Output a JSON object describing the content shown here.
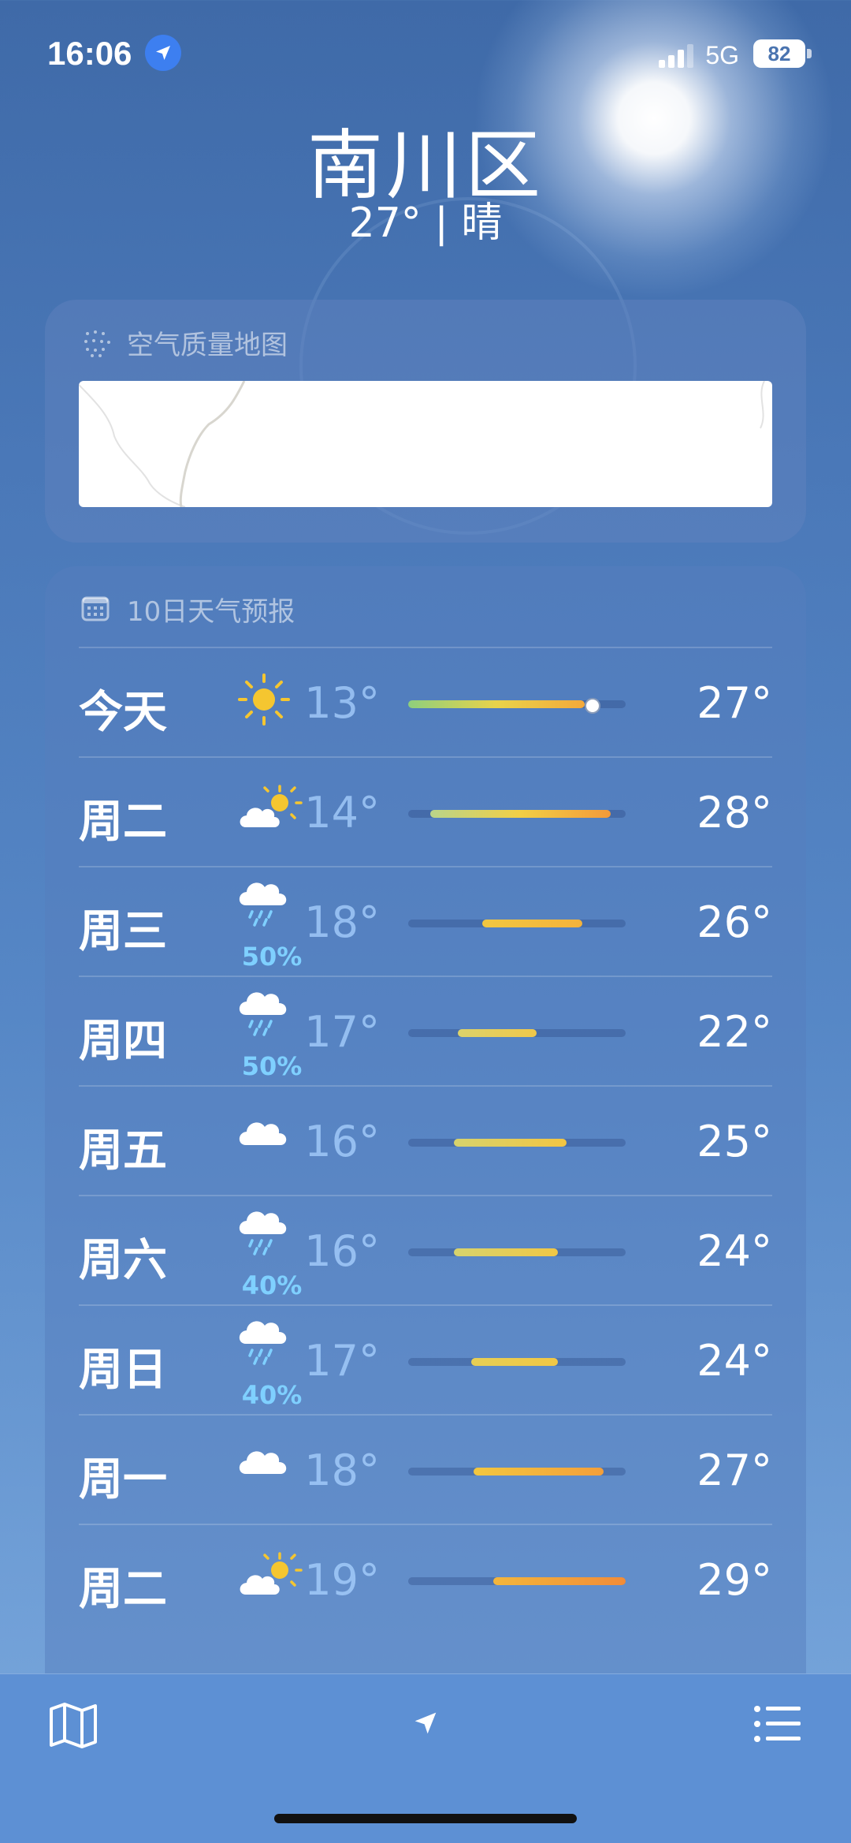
{
  "status": {
    "time": "16:06",
    "network": "5G",
    "battery": "82"
  },
  "location": {
    "city": "南川区",
    "summary": "27° | 晴"
  },
  "air_quality": {
    "title": "空气质量地图"
  },
  "forecast": {
    "title": "10日天气预报",
    "days": [
      {
        "day": "今天",
        "icon": "sun-icon",
        "precip": "",
        "low": "13°",
        "high": "27°",
        "bar_start": 0.0,
        "bar_end": 0.81,
        "current": 0.84,
        "color": "linear-gradient(90deg,#8ecf7d,#e9d34a,#f4a93a)"
      },
      {
        "day": "周二",
        "icon": "partly-sunny-icon",
        "precip": "",
        "low": "14°",
        "high": "28°",
        "bar_start": 0.1,
        "bar_end": 0.93,
        "color": "linear-gradient(90deg,#b9d48a,#f2cf45,#f39a3a)"
      },
      {
        "day": "周三",
        "icon": "cloud-rain-icon",
        "precip": "50%",
        "low": "18°",
        "high": "26°",
        "bar_start": 0.34,
        "bar_end": 0.8,
        "color": "linear-gradient(90deg,#f2c740,#f4b23b)"
      },
      {
        "day": "周四",
        "icon": "cloud-rain-icon",
        "precip": "50%",
        "low": "17°",
        "high": "22°",
        "bar_start": 0.23,
        "bar_end": 0.59,
        "color": "linear-gradient(90deg,#dcd26a,#f0c84a)"
      },
      {
        "day": "周五",
        "icon": "cloud-icon",
        "precip": "",
        "low": "16°",
        "high": "25°",
        "bar_start": 0.21,
        "bar_end": 0.73,
        "color": "linear-gradient(90deg,#d7d36d,#f3c542)"
      },
      {
        "day": "周六",
        "icon": "cloud-rain-icon",
        "precip": "40%",
        "low": "16°",
        "high": "24°",
        "bar_start": 0.21,
        "bar_end": 0.69,
        "color": "linear-gradient(90deg,#d7d36d,#f1c745)"
      },
      {
        "day": "周日",
        "icon": "cloud-rain-icon",
        "precip": "40%",
        "low": "17°",
        "high": "24°",
        "bar_start": 0.29,
        "bar_end": 0.69,
        "color": "linear-gradient(90deg,#e6cf55,#f1c745)"
      },
      {
        "day": "周一",
        "icon": "cloud-icon",
        "precip": "",
        "low": "18°",
        "high": "27°",
        "bar_start": 0.3,
        "bar_end": 0.9,
        "color": "linear-gradient(90deg,#f2c740,#f39f3a)"
      },
      {
        "day": "周二",
        "icon": "partly-sunny-icon",
        "precip": "",
        "low": "19°",
        "high": "29°",
        "bar_start": 0.39,
        "bar_end": 1.0,
        "color": "linear-gradient(90deg,#f3b63c,#f28c38)"
      }
    ]
  },
  "toolbar": {
    "map": "map-icon",
    "location": "location-arrow-icon",
    "list": "list-icon"
  }
}
